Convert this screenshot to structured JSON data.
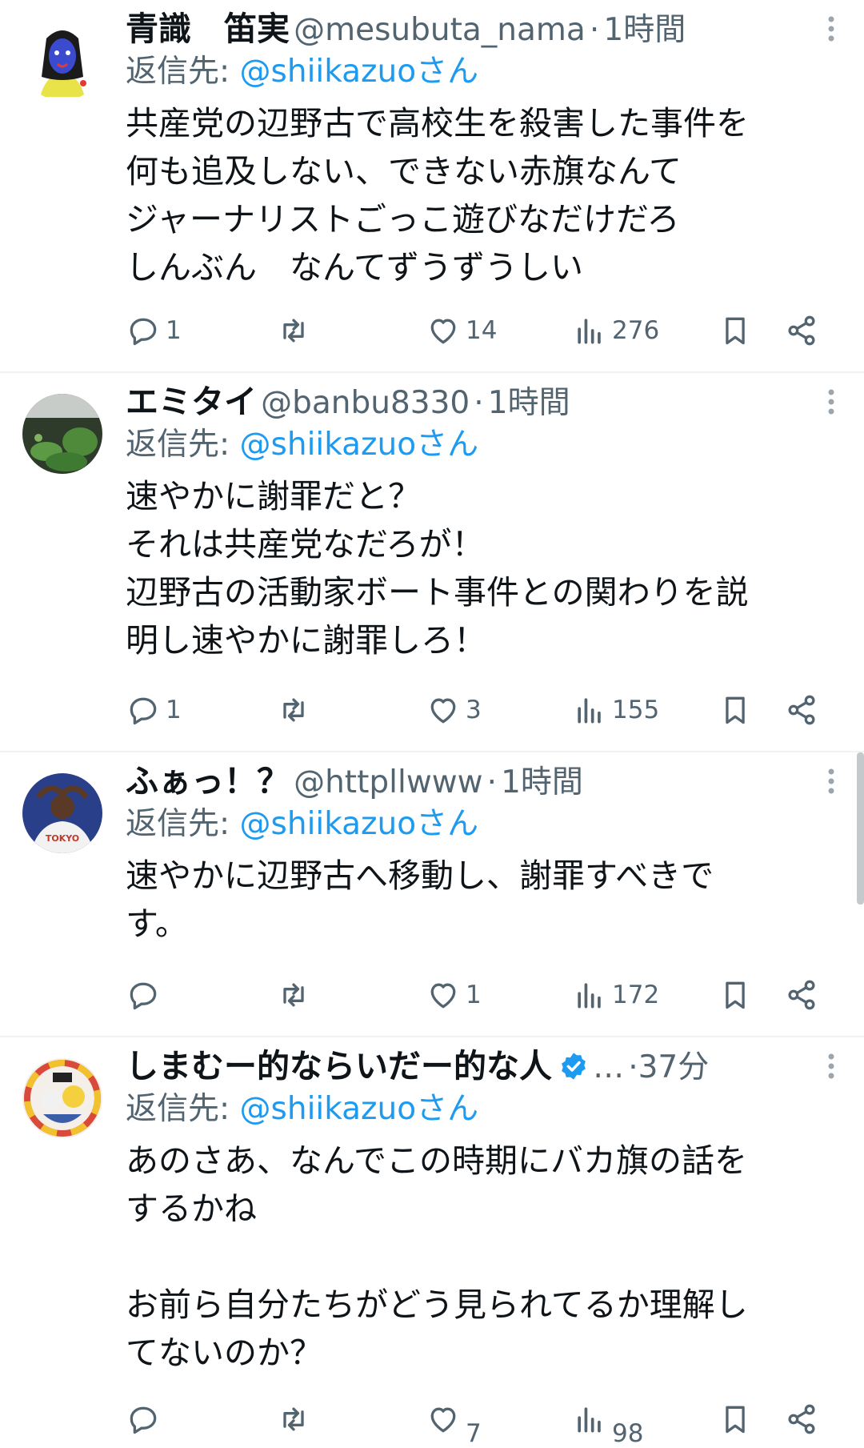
{
  "tweets": [
    {
      "name": "青識　笛実",
      "handle": "@mesubuta_nama",
      "separator": "·",
      "time": "1時間",
      "reply_prefix": "返信先: ",
      "reply_to": "@shiikazuoさん",
      "body": "共産党の辺野古で高校生を殺害した事件を\n何も追及しない、できない赤旗なんて\nジャーナリストごっこ遊びなだけだろ\nしんぶん　なんてずうずうしい",
      "replies": "1",
      "retweets": "",
      "likes": "14",
      "views": "276"
    },
    {
      "name": "エミタイ",
      "handle": "@banbu8330",
      "separator": "·",
      "time": "1時間",
      "reply_prefix": "返信先: ",
      "reply_to": "@shiikazuoさん",
      "body": "速やかに謝罪だと？\nそれは共産党なだろが！\n辺野古の活動家ボート事件との関わりを説\n明し速やかに謝罪しろ！",
      "replies": "1",
      "retweets": "",
      "likes": "3",
      "views": "155"
    },
    {
      "name": "ふぁっ！？",
      "handle": "@httpllwww",
      "separator": "·",
      "time": "1時間",
      "reply_prefix": "返信先: ",
      "reply_to": "@shiikazuoさん",
      "body": "速やかに辺野古へ移動し、謝罪すべきで\nす。",
      "replies": "",
      "retweets": "",
      "likes": "1",
      "views": "172"
    },
    {
      "name": "しまむー的ならいだー的な人",
      "handle": "…",
      "separator": "·",
      "time": "37分",
      "reply_prefix": "返信先: ",
      "reply_to": "@shiikazuoさん",
      "body": "あのさあ、なんでこの時期にバカ旗の話を\nするかね\n\nお前ら自分たちがどう見られてるか理解し\nてないのか？",
      "replies": "",
      "retweets": "",
      "likes": "7",
      "views": "98",
      "verified": true
    }
  ],
  "colors": {
    "text": "#0f1419",
    "secondary": "#536471",
    "link": "#1d9bf0",
    "divider": "#eff3f4"
  },
  "icons": [
    "reply-icon",
    "retweet-icon",
    "like-icon",
    "views-icon",
    "bookmark-icon",
    "share-icon",
    "more-icon",
    "verified-icon"
  ]
}
